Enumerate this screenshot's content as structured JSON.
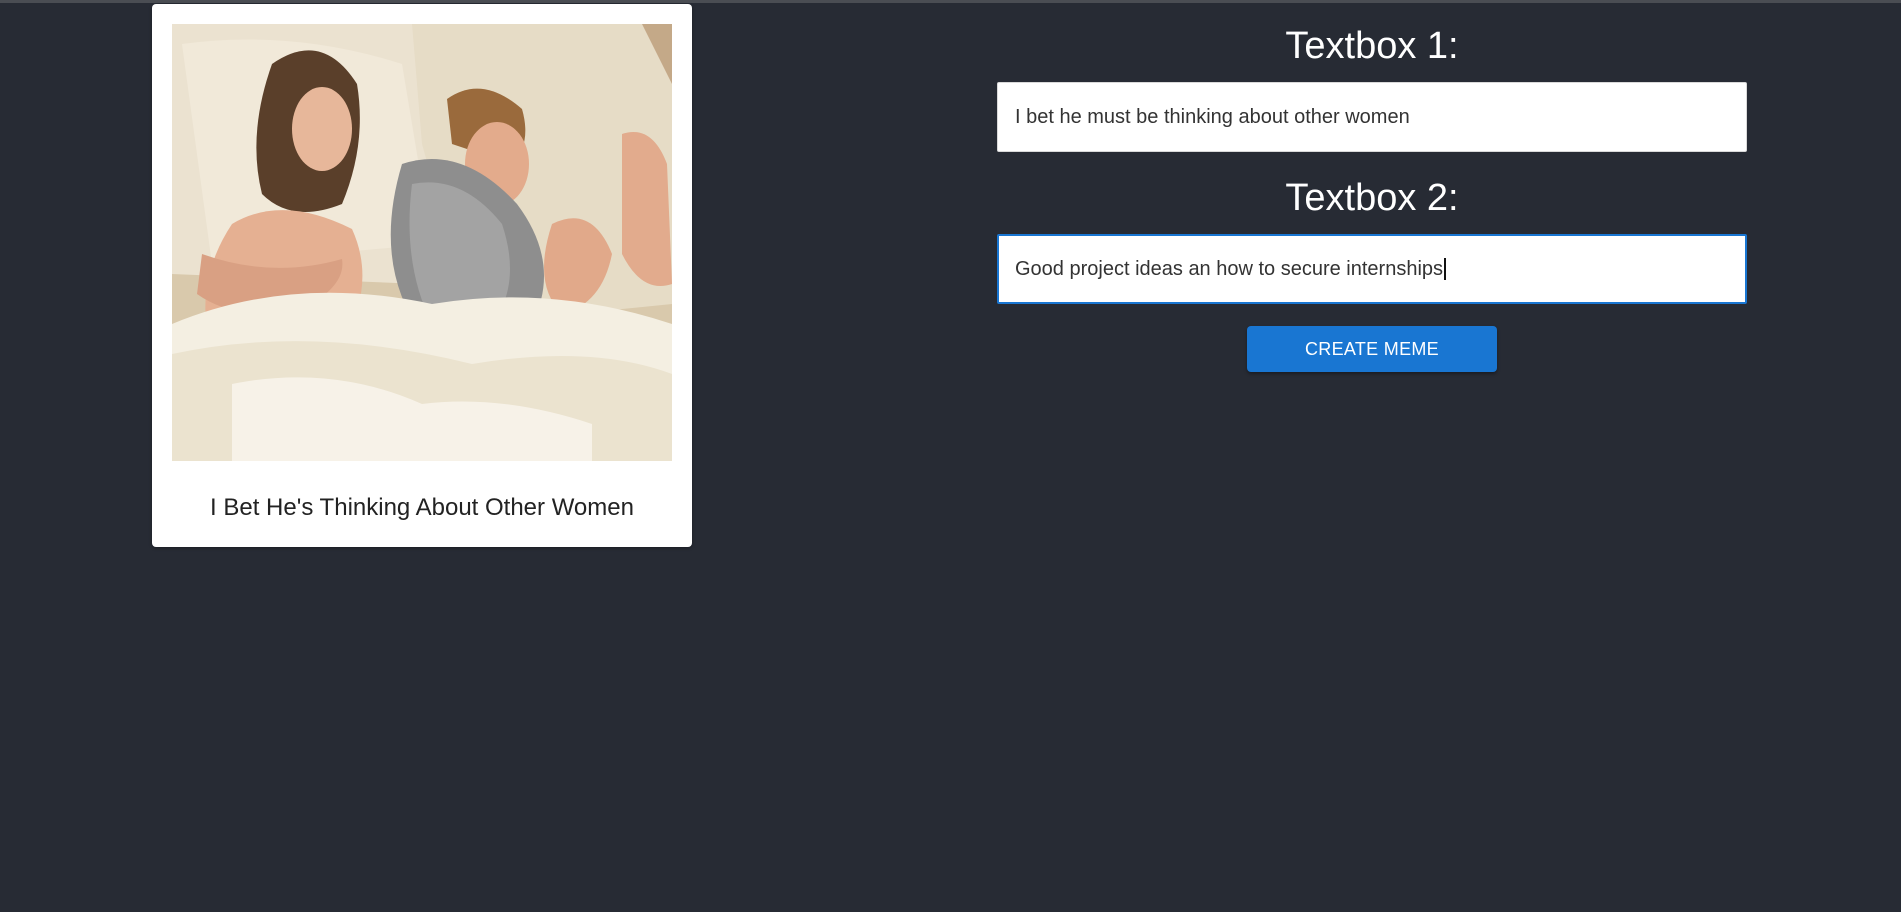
{
  "meme_card": {
    "image_alt": "two people lying in bed looking away from each other",
    "title": "I Bet He's Thinking About Other Women"
  },
  "form": {
    "textbox1_label": "Textbox 1:",
    "textbox1_value": "I bet he must be thinking about other women",
    "textbox2_label": "Textbox 2:",
    "textbox2_value": "Good project ideas an how to secure internships",
    "submit_label": "CREATE MEME"
  },
  "colors": {
    "background": "#272b34",
    "accent": "#1976d2",
    "card": "#ffffff"
  }
}
